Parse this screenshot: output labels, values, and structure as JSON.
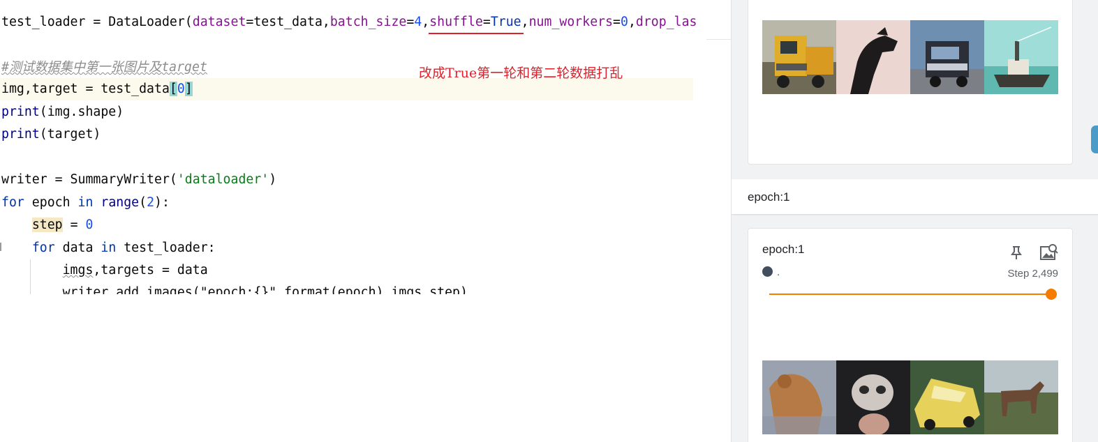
{
  "editor": {
    "annotation": "改成True第一轮和第二轮数据打乱",
    "lines": {
      "l1": {
        "a": "test_loader = DataLoader(",
        "p1": "dataset",
        "b": "=test_data,",
        "p2": "batch_size",
        "c": "=",
        "n1": "4",
        "d": ",",
        "p3": "shuffle",
        "e": "=",
        "k1": "True",
        "f": ",",
        "p4": "num_workers",
        "g": "=",
        "n2": "0",
        "h": ",",
        "p5": "drop_las"
      },
      "l2": {
        "comment": "#测试数据集中第一张图片及target"
      },
      "l3": {
        "a": "img,target = test_data",
        "open": "[",
        "n": "0",
        "close": "]"
      },
      "l4": {
        "fn": "print",
        "rest": "(img.shape)"
      },
      "l5": {
        "fn": "print",
        "rest": "(target)"
      },
      "l6": {
        "a": "writer = SummaryWriter(",
        "s": "'dataloader'",
        "b": ")"
      },
      "l7": {
        "k1": "for",
        "a": " epoch ",
        "k2": "in",
        "b": " ",
        "fn": "range",
        "c": "(",
        "n": "2",
        "d": "):"
      },
      "l8": {
        "indent": "    ",
        "v": "step",
        "a": " = ",
        "n": "0"
      },
      "l9": {
        "indent": "    ",
        "k1": "for",
        "a": " data ",
        "k2": "in",
        "b": " test_loader:"
      },
      "l10": {
        "indent": "        ",
        "v": "imgs",
        "a": ",targets = data"
      },
      "l11": {
        "text": "        writer.add_images(\"epoch:{}\".format(epoch),imgs,step)"
      }
    }
  },
  "tensorboard": {
    "section_title": "epoch:1",
    "card": {
      "title": "epoch:1",
      "run_label": ".",
      "step_label": "Step 2,499",
      "slider_fraction": 1.0
    }
  },
  "colors": {
    "accent": "#f57c00",
    "annotation_red": "#e0202a",
    "keyword": "#0033b3",
    "parameter": "#871094",
    "number": "#1750eb",
    "string": "#067d17"
  }
}
